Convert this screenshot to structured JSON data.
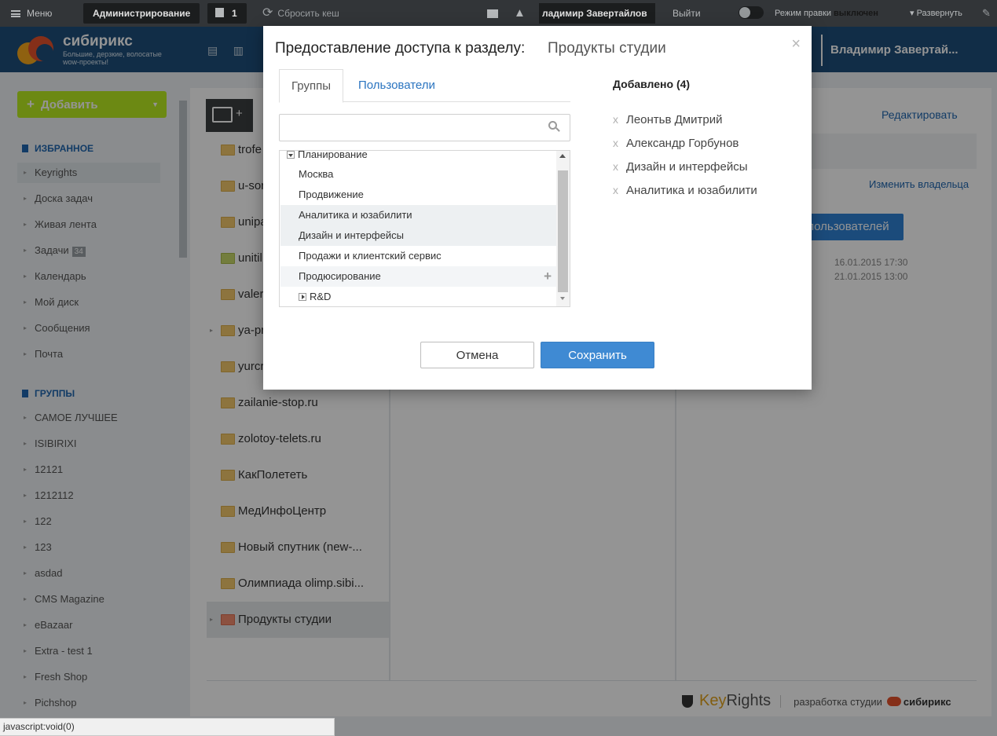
{
  "adminbar": {
    "menu": "Меню",
    "admin": "Администрирование",
    "notif_count": "1",
    "cache": "Сбросить кеш",
    "user": "ладимир Завертайлов",
    "logout": "Выйти",
    "edit_mode": "Режим правки",
    "edit_state": "выключен",
    "expand": "Развернуть"
  },
  "header": {
    "logo_name": "сибирикс",
    "logo_slogan": "Большие, дерзкие, волосатые wow-проекты!",
    "user": "Владимир Завертай..."
  },
  "sidebar": {
    "add_button": "Добавить",
    "favorites_title": "ИЗБРАННОЕ",
    "favorites": [
      {
        "label": "Keyrights"
      },
      {
        "label": "Доска задач"
      },
      {
        "label": "Живая лента"
      },
      {
        "label": "Задачи",
        "count": "34"
      },
      {
        "label": "Календарь"
      },
      {
        "label": "Мой диск"
      },
      {
        "label": "Сообщения"
      },
      {
        "label": "Почта"
      }
    ],
    "groups_title": "ГРУППЫ",
    "groups": [
      "САМОЕ ЛУЧШЕЕ",
      "ISIBIRIXI",
      "12121",
      "1212112",
      "122",
      "123",
      "asdad",
      "CMS Magazine",
      "eBazaar",
      "Extra - test 1",
      "Fresh Shop",
      "Pichshop"
    ]
  },
  "folders": [
    "trofe",
    "u-sor",
    "unipa",
    "unitil",
    "valer",
    "ya-pr",
    "yurcr",
    "zailanie-stop.ru",
    "zolotoy-telets.ru",
    "КакПолететь",
    "МедИнфоЦентр",
    "Новый спутник (new-...",
    "Олимпиада olimp.sibi...",
    "Продукты студии"
  ],
  "right_panel": {
    "edit": "Редактировать",
    "change_owner": "Изменить владельца",
    "users_button": "пользователей",
    "dates": [
      "16.01.2015 17:30",
      "21.01.2015 13:00"
    ]
  },
  "footer": {
    "brand_key": "Key",
    "brand_rights": "Rights",
    "dev_text": "разработка студии",
    "dev_logo": "сибирикс"
  },
  "statusbar": "javascript:void(0)",
  "dialog": {
    "title": "Предоставление доступа к разделу:",
    "section": "Продукты студии",
    "tabs": [
      "Группы",
      "Пользователи"
    ],
    "search_value": "",
    "tree": [
      {
        "label": "Планирование",
        "type": "partial"
      },
      {
        "label": "Москва"
      },
      {
        "label": "Продвижение"
      },
      {
        "label": "Аналитика и юзабилити",
        "state": "selected"
      },
      {
        "label": "Дизайн и интерфейсы",
        "state": "selected"
      },
      {
        "label": "Продажи и клиентский сервис"
      },
      {
        "label": "Продюсирование",
        "state": "hover"
      },
      {
        "label": "R&D",
        "type": "collapsed"
      }
    ],
    "added_title": "Добавлено (4)",
    "added": [
      "Леонтьв Дмитрий",
      "Александр Горбунов",
      "Дизайн и интерфейсы",
      "Аналитика и юзабилити"
    ],
    "remove_glyph": "x",
    "cancel": "Отмена",
    "save": "Сохранить"
  }
}
